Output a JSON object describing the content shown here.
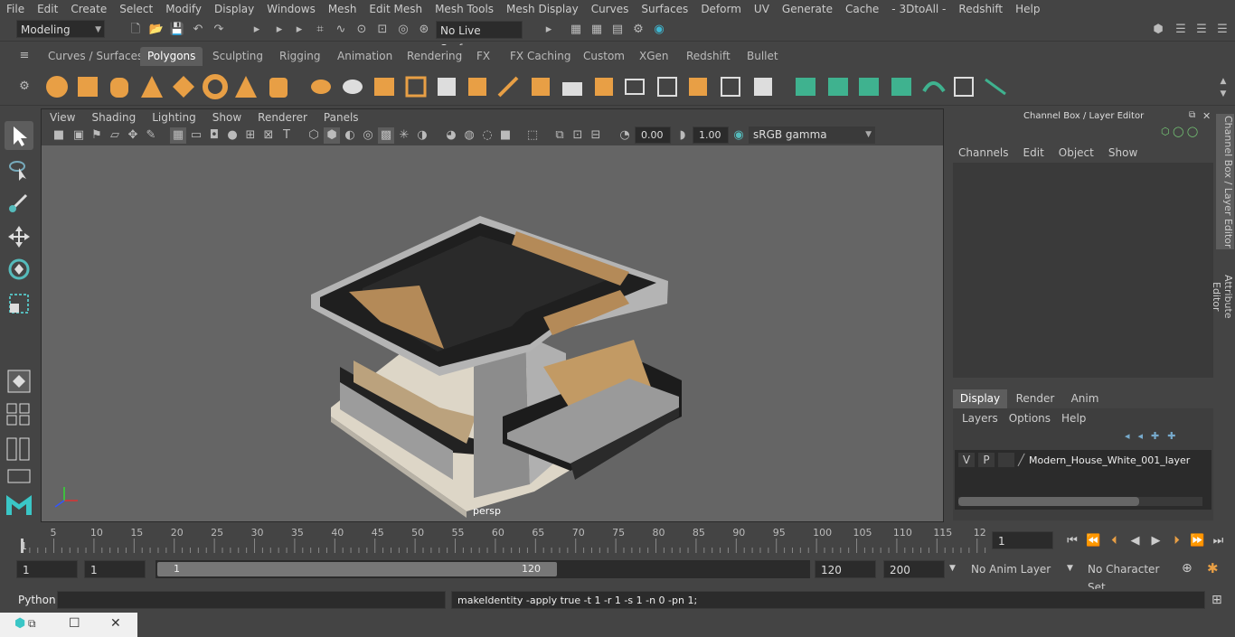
{
  "menubar": [
    "File",
    "Edit",
    "Create",
    "Select",
    "Modify",
    "Display",
    "Windows",
    "Mesh",
    "Edit Mesh",
    "Mesh Tools",
    "Mesh Display",
    "Curves",
    "Surfaces",
    "Deform",
    "UV",
    "Generate",
    "Cache",
    "- 3DtoAll -",
    "Redshift",
    "Help"
  ],
  "status": {
    "mode": "Modeling",
    "live_surface": "No Live Surface"
  },
  "shelf_tabs": [
    "Curves / Surfaces",
    "Polygons",
    "Sculpting",
    "Rigging",
    "Animation",
    "Rendering",
    "FX",
    "FX Caching",
    "Custom",
    "XGen",
    "Redshift",
    "Bullet"
  ],
  "shelf_active": "Polygons",
  "viewport": {
    "menu": [
      "View",
      "Shading",
      "Lighting",
      "Show",
      "Renderer",
      "Panels"
    ],
    "exposure": "0.00",
    "gamma": "1.00",
    "color_space": "sRGB gamma",
    "camera": "persp"
  },
  "channel_box": {
    "title": "Channel Box / Layer Editor",
    "menu": [
      "Channels",
      "Edit",
      "Object",
      "Show"
    ],
    "tabs": [
      "Display",
      "Render",
      "Anim"
    ],
    "active_tab": "Display",
    "layer_menu": [
      "Layers",
      "Options",
      "Help"
    ],
    "layer": {
      "v": "V",
      "p": "P",
      "name": "Modern_House_White_001_layer"
    }
  },
  "side_tabs": [
    "Channel Box / Layer Editor",
    "Attribute Editor"
  ],
  "timeline": {
    "ticks": [
      "5",
      "10",
      "15",
      "20",
      "25",
      "30",
      "35",
      "40",
      "45",
      "50",
      "55",
      "60",
      "65",
      "70",
      "75",
      "80",
      "85",
      "90",
      "95",
      "100",
      "105",
      "110",
      "115",
      "12"
    ],
    "start_label": "1",
    "current_frame": "1"
  },
  "range": {
    "start": "1",
    "start2": "1",
    "slider_start": "1",
    "slider_end": "120",
    "end": "120",
    "end2": "200",
    "anim_layer": "No Anim Layer",
    "char_set": "No Character Set"
  },
  "cmdline": {
    "lang": "Python",
    "output": "makeIdentity -apply true -t 1 -r 1 -s 1 -n 0 -pn 1;"
  },
  "colors": {
    "accent": "#5285a6",
    "shelf_orange": "#e89f45",
    "shelf_green": "#3fb28f"
  }
}
